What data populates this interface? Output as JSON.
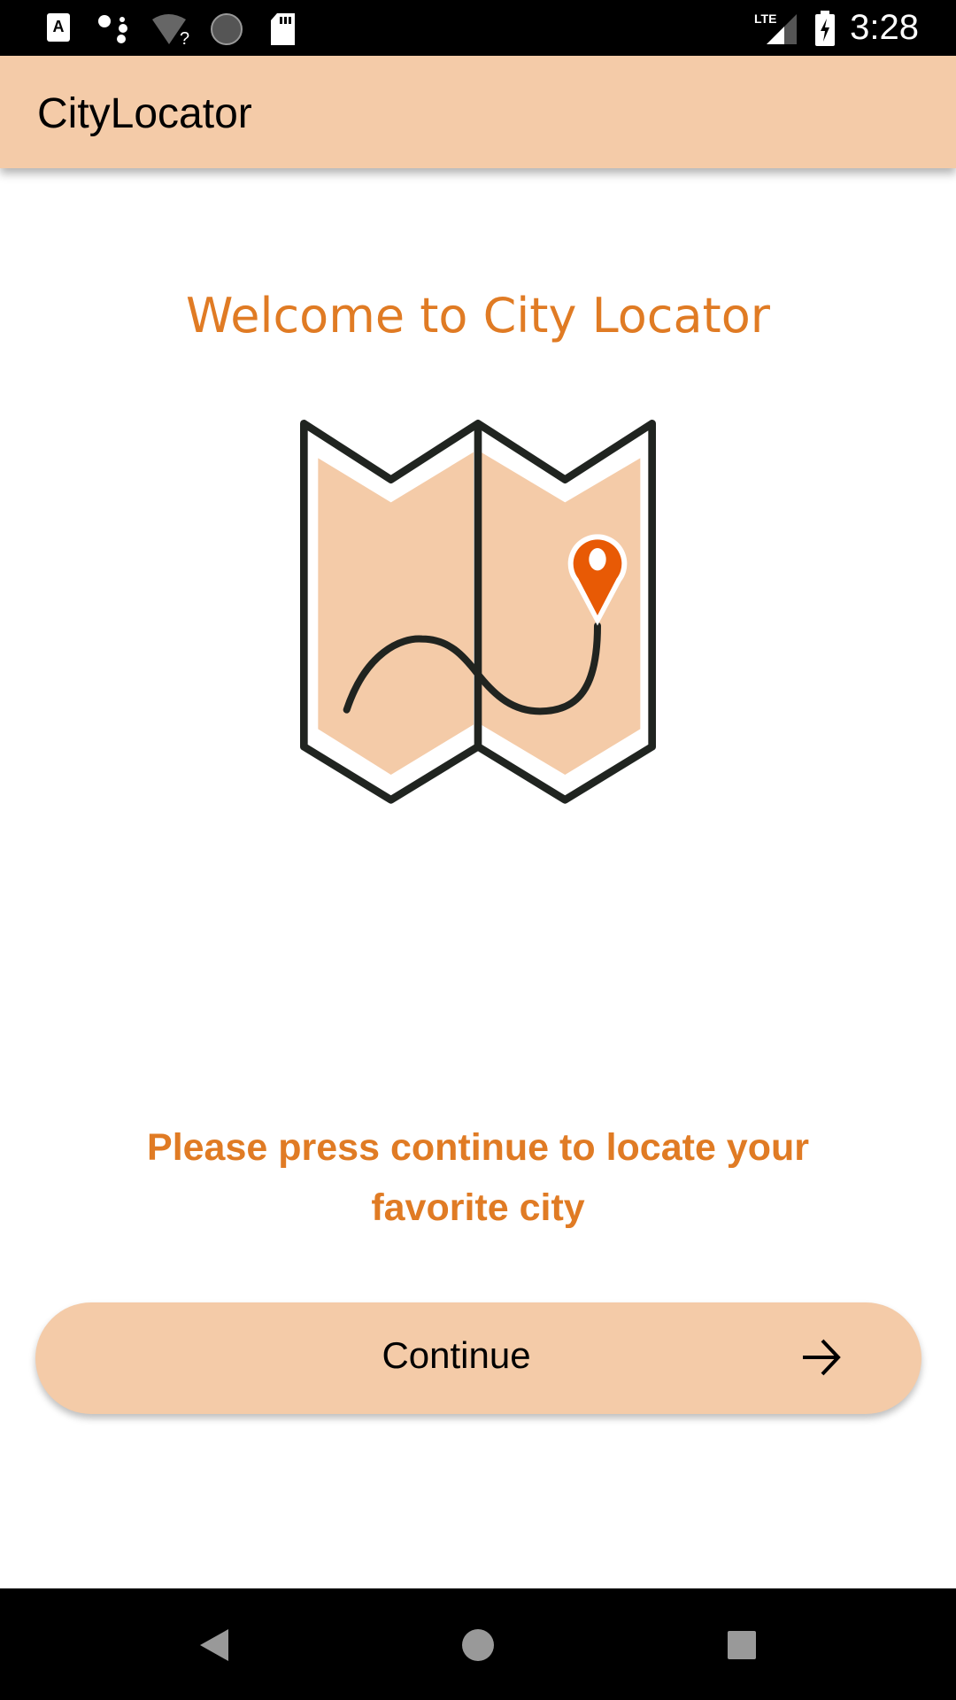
{
  "status_bar": {
    "time": "3:28",
    "network": "LTE",
    "icons": [
      "a-notification-icon",
      "assistant-icon",
      "wifi-unknown-icon",
      "sync-icon",
      "sd-card-icon",
      "signal-icon",
      "battery-charging-icon"
    ]
  },
  "app_bar": {
    "title": "CityLocator"
  },
  "main": {
    "welcome": "Welcome to City Locator",
    "prompt": "Please press continue to locate your favorite city",
    "continue_label": "Continue"
  },
  "colors": {
    "accent": "#E07B24",
    "primary": "#F4CBA8",
    "pin": "#E85A05",
    "outline": "#202420"
  }
}
